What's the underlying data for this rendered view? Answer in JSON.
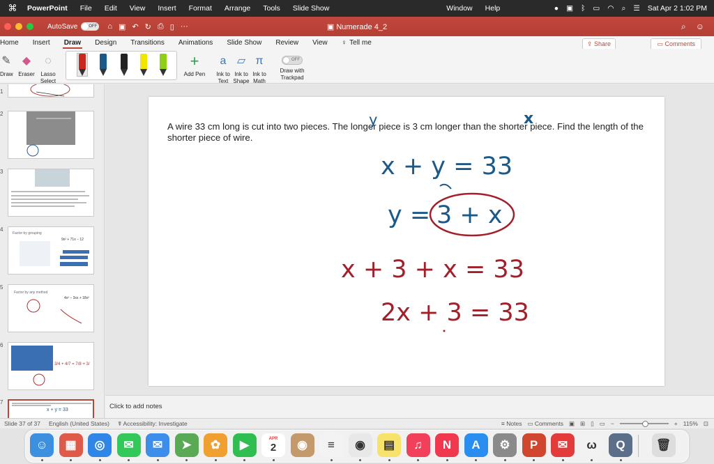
{
  "menubar": {
    "app_name": "PowerPoint",
    "items": [
      "File",
      "Edit",
      "View",
      "Insert",
      "Format",
      "Arrange",
      "Tools",
      "Slide Show"
    ],
    "right_items": [
      "Window",
      "Help"
    ],
    "datetime": "Sat Apr 2  1:02 PM"
  },
  "titlebar": {
    "autosave_label": "AutoSave",
    "autosave_state": "OFF",
    "document_title": "Numerade 4_2"
  },
  "ribbon_tabs": [
    "Home",
    "Insert",
    "Draw",
    "Design",
    "Transitions",
    "Animations",
    "Slide Show",
    "Review",
    "View"
  ],
  "active_tab": "Draw",
  "tell_me": "Tell me",
  "share_label": "Share",
  "comments_label": "Comments",
  "draw_tools": {
    "draw": "Draw",
    "eraser": "Eraser",
    "lasso": "Lasso\nSelect",
    "add_pen": "Add Pen",
    "ink_to_text": "Ink to\nText",
    "ink_to_shape": "Ink to\nShape",
    "ink_to_math": "Ink to\nMath",
    "trackpad_state": "OFF",
    "trackpad_label": "Draw with\nTrackpad"
  },
  "pen_colors": [
    "#c8281e",
    "#1a5a8a",
    "#222222",
    "#f2e600",
    "#8fd016"
  ],
  "thumbnails": [
    "1",
    "2",
    "3",
    "4",
    "5",
    "6",
    "7"
  ],
  "thumb_text": {
    "t4_title": "Factor by grouping",
    "t4_formula": "9x² + 71x − 12",
    "t5_title": "Factor by any method",
    "t5_formula": "4x² − 3xx + 18x²",
    "t6_eq": "3/4 + 4/7 = 7/8 + 3/",
    "t7_eq": "x + y = 33"
  },
  "slide": {
    "problem_text": "A wire 33 cm long is cut into two pieces. The longer piece is 3 cm longer than the shorter piece. Find the length of the shorter piece of wire.",
    "ink": {
      "y_mark": "y",
      "x_mark": "x",
      "eq1": "x + y = 33",
      "eq2": "y = ",
      "eq2_boxed": "3 + x",
      "eq3": "x + 3 + x  = 33",
      "eq4": "2x + 3 = 33"
    },
    "ink_colors": {
      "blue": "#1a5a8a",
      "red": "#a31f2a"
    }
  },
  "notes_placeholder": "Click to add notes",
  "statusbar": {
    "slide_info": "Slide 37 of 37",
    "language": "English (United States)",
    "accessibility": "Accessibility: Investigate",
    "notes": "Notes",
    "comments": "Comments",
    "zoom": "115%"
  },
  "dock": [
    {
      "name": "finder",
      "color": "#3d8fe0",
      "glyph": "☺"
    },
    {
      "name": "launchpad",
      "color": "#e05a4a",
      "glyph": "▦"
    },
    {
      "name": "safari",
      "color": "#2f86e6",
      "glyph": "◎"
    },
    {
      "name": "messages",
      "color": "#32c85a",
      "glyph": "✉"
    },
    {
      "name": "mail",
      "color": "#3c8eea",
      "glyph": "✉"
    },
    {
      "name": "maps",
      "color": "#5aaa55",
      "glyph": "➤"
    },
    {
      "name": "photos",
      "color": "#f0a030",
      "glyph": "✿"
    },
    {
      "name": "facetime",
      "color": "#2fbe4f",
      "glyph": "▶"
    },
    {
      "name": "calendar",
      "color": "#ffffff",
      "glyph": "2",
      "month": "APR"
    },
    {
      "name": "contacts",
      "color": "#c49a6c",
      "glyph": "◉"
    },
    {
      "name": "reminders",
      "color": "#f3f3f3",
      "glyph": "≡"
    },
    {
      "name": "chrome",
      "color": "#e8e8e8",
      "glyph": "◉"
    },
    {
      "name": "notes",
      "color": "#f7e26b",
      "glyph": "▤"
    },
    {
      "name": "music",
      "color": "#f2405a",
      "glyph": "♫"
    },
    {
      "name": "news",
      "color": "#f0394f",
      "glyph": "N"
    },
    {
      "name": "app-store",
      "color": "#2a8ef0",
      "glyph": "A"
    },
    {
      "name": "system-preferences",
      "color": "#8a8a8a",
      "glyph": "⚙"
    },
    {
      "name": "powerpoint",
      "color": "#d0462f",
      "glyph": "P"
    },
    {
      "name": "outlook-mail",
      "color": "#e33b3b",
      "glyph": "✉"
    },
    {
      "name": "numerade",
      "color": "#f2f2f2",
      "glyph": "ω"
    },
    {
      "name": "quicktime",
      "color": "#5b6f8a",
      "glyph": "Q"
    },
    {
      "name": "trash",
      "color": "#dddddd",
      "glyph": "🗑"
    }
  ]
}
